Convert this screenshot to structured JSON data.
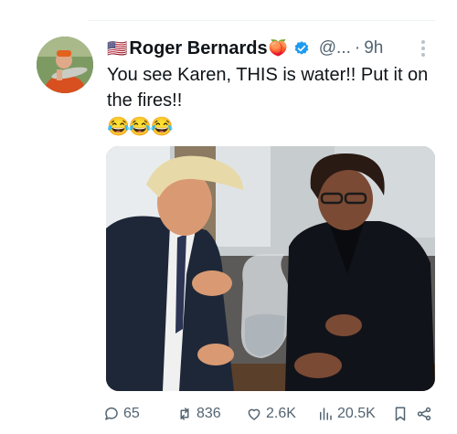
{
  "tweet": {
    "flag_emoji": "🇺🇸",
    "author_name": "Roger Bernards",
    "name_emoji": "🍑",
    "handle": "@...",
    "separator": "·",
    "time": "9h",
    "text": "You see Karen, THIS is water!!  Put it on the fires!!",
    "emoji_line": "😂😂😂",
    "verified_color": "#1d9bf0"
  },
  "actions": {
    "replies": "65",
    "reposts": "836",
    "likes": "2.6K",
    "views": "20.5K"
  },
  "colors": {
    "text": "#0f1419",
    "muted": "#536471",
    "accent": "#1d9bf0"
  }
}
